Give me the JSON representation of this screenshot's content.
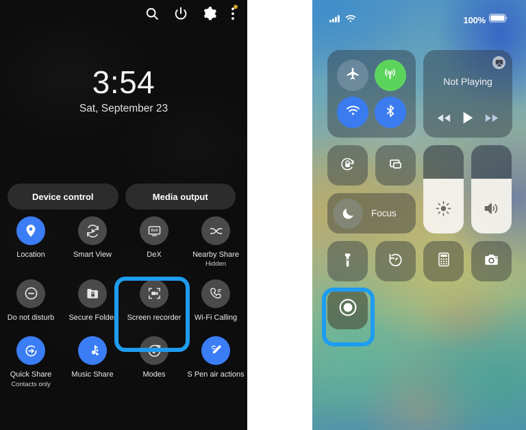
{
  "colors": {
    "highlight": "#1e9cf0",
    "android_accent": "#3b7df5",
    "android_off": "#4a4a4a",
    "ios_green": "#5cd45c",
    "ios_blue": "#3a7bf0",
    "notification_dot": "#d8a42a",
    "panel_bg": "#0d0d0d"
  },
  "android": {
    "statusbar": {
      "icons": [
        {
          "name": "search-icon",
          "label": "Search"
        },
        {
          "name": "power-icon",
          "label": "Power"
        },
        {
          "name": "settings-gear-icon",
          "label": "Settings"
        },
        {
          "name": "overflow-menu-icon",
          "label": "More options",
          "badge": true
        }
      ]
    },
    "clock": {
      "time": "3:54",
      "date": "Sat, September 23"
    },
    "pills": [
      {
        "label": "Device control",
        "name": "device-control-button"
      },
      {
        "label": "Media output",
        "name": "media-output-button"
      }
    ],
    "tiles": [
      {
        "label": "Location",
        "sub": "",
        "icon": "location-pin-icon",
        "state": "on",
        "name": "quick-tile-location"
      },
      {
        "label": "Smart View",
        "sub": "",
        "icon": "smart-view-icon",
        "state": "off",
        "name": "quick-tile-smart-view"
      },
      {
        "label": "DeX",
        "sub": "",
        "icon": "dex-icon",
        "state": "off",
        "name": "quick-tile-dex"
      },
      {
        "label": "Nearby Share",
        "sub": "Hidden",
        "icon": "nearby-share-icon",
        "state": "off",
        "name": "quick-tile-nearby-share"
      },
      {
        "label": "Do not disturb",
        "sub": "",
        "icon": "do-not-disturb-icon",
        "state": "off",
        "name": "quick-tile-do-not-disturb"
      },
      {
        "label": "Secure Folder",
        "sub": "",
        "icon": "secure-folder-icon",
        "state": "off",
        "name": "quick-tile-secure-folder"
      },
      {
        "label": "Screen recorder",
        "sub": "",
        "icon": "screen-recorder-icon",
        "state": "off",
        "name": "quick-tile-screen-recorder"
      },
      {
        "label": "Wi-Fi Calling",
        "sub": "",
        "icon": "wifi-calling-icon",
        "state": "off",
        "name": "quick-tile-wifi-calling"
      },
      {
        "label": "Quick Share",
        "sub": "Contacts only",
        "icon": "quick-share-icon",
        "state": "on",
        "name": "quick-tile-quick-share"
      },
      {
        "label": "Music Share",
        "sub": "",
        "icon": "music-share-icon",
        "state": "on",
        "name": "quick-tile-music-share"
      },
      {
        "label": "Modes",
        "sub": "",
        "icon": "modes-icon",
        "state": "off",
        "name": "quick-tile-modes"
      },
      {
        "label": "S Pen air actions",
        "sub": "",
        "icon": "s-pen-icon",
        "state": "on",
        "name": "quick-tile-s-pen-air-actions"
      }
    ],
    "highlight_target": "Screen recorder"
  },
  "ios": {
    "statusbar": {
      "signal_icon": "cellular-signal-icon",
      "wifi_icon": "wifi-icon",
      "battery_percent": "100%",
      "battery_icon": "battery-full-icon"
    },
    "connectivity": [
      {
        "label": "Airplane Mode",
        "icon": "airplane-icon",
        "state": "off",
        "name": "cc-airplane-mode"
      },
      {
        "label": "Cellular Data",
        "icon": "cellular-icon",
        "state": "on",
        "name": "cc-cellular-data"
      },
      {
        "label": "Wi-Fi",
        "icon": "wifi-icon",
        "state": "on",
        "name": "cc-wifi"
      },
      {
        "label": "Bluetooth",
        "icon": "bluetooth-icon",
        "state": "on",
        "name": "cc-bluetooth"
      }
    ],
    "media": {
      "title": "Not Playing",
      "airplay_icon": "airplay-icon",
      "controls": [
        {
          "icon": "rewind-icon",
          "name": "cc-media-rewind"
        },
        {
          "icon": "play-icon",
          "name": "cc-media-play"
        },
        {
          "icon": "forward-icon",
          "name": "cc-media-forward"
        }
      ]
    },
    "small_tiles": [
      {
        "label": "Rotation Lock",
        "icon": "rotation-lock-icon",
        "name": "cc-rotation-lock"
      },
      {
        "label": "Screen Mirroring",
        "icon": "screen-mirroring-icon",
        "name": "cc-screen-mirroring"
      }
    ],
    "focus": {
      "label": "Focus",
      "icon": "moon-icon",
      "name": "cc-focus"
    },
    "sliders": [
      {
        "label": "Brightness",
        "icon": "brightness-sun-icon",
        "value": 62,
        "name": "cc-brightness-slider"
      },
      {
        "label": "Volume",
        "icon": "volume-icon",
        "value": 62,
        "name": "cc-volume-slider"
      }
    ],
    "bottom_tiles": [
      {
        "label": "Flashlight",
        "icon": "flashlight-icon",
        "name": "cc-flashlight"
      },
      {
        "label": "Timer",
        "icon": "timer-icon",
        "name": "cc-timer"
      },
      {
        "label": "Calculator",
        "icon": "calculator-icon",
        "name": "cc-calculator"
      },
      {
        "label": "Camera",
        "icon": "camera-icon",
        "name": "cc-camera"
      }
    ],
    "screen_record": {
      "label": "Screen Recording",
      "icon": "screen-record-icon",
      "name": "cc-screen-recording"
    },
    "highlight_target": "Screen Recording"
  }
}
